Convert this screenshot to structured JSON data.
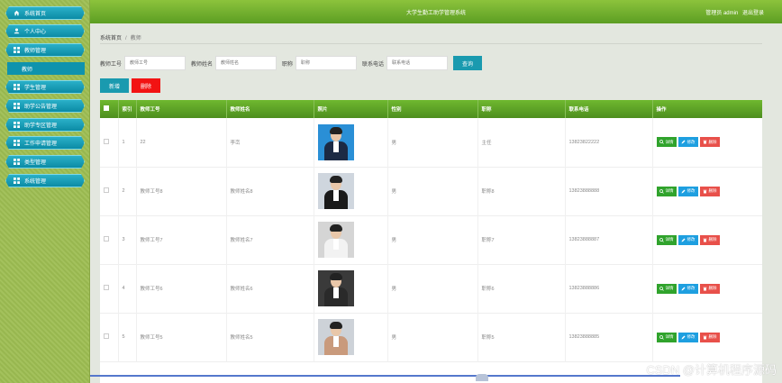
{
  "app": {
    "title": "大学生勤工助学管理系统",
    "user_label": "管理员 admin",
    "logout": "退出登录"
  },
  "sidebar": {
    "items": [
      {
        "label": "系统首页",
        "icon": "home-icon"
      },
      {
        "label": "个人中心",
        "icon": "user-icon"
      },
      {
        "label": "教师管理",
        "icon": "grid-icon"
      },
      {
        "label": "学生管理",
        "icon": "grid-icon"
      },
      {
        "label": "助学公告管理",
        "icon": "grid-icon"
      },
      {
        "label": "助学专区管理",
        "icon": "grid-icon"
      },
      {
        "label": "工作申请管理",
        "icon": "grid-icon"
      },
      {
        "label": "类型管理",
        "icon": "grid-icon"
      },
      {
        "label": "系统管理",
        "icon": "grid-icon"
      }
    ],
    "submenu": {
      "label": "教师"
    }
  },
  "breadcrumb": {
    "home": "系统首页",
    "sep": "/",
    "current": "教师"
  },
  "search": {
    "teacher_no_label": "教师工号",
    "teacher_no_placeholder": "教师工号",
    "teacher_name_label": "教师姓名",
    "teacher_name_placeholder": "教师姓名",
    "title_label": "职称",
    "title_placeholder": "职称",
    "phone_label": "联系电话",
    "phone_placeholder": "联系电话",
    "query_button": "查询"
  },
  "actions": {
    "add": "新增",
    "delete": "删除"
  },
  "table": {
    "headers": [
      "索引",
      "教师工号",
      "教师姓名",
      "照片",
      "性别",
      "职称",
      "联系电话",
      "操作"
    ],
    "rows": [
      {
        "index": "1",
        "no": "22",
        "name": "李峦",
        "gender": "男",
        "title": "主任",
        "phone": "13823822222",
        "photo_bg": "#2a8fd6",
        "suit": "#1c2a44"
      },
      {
        "index": "2",
        "no": "教师工号8",
        "name": "教师姓名8",
        "gender": "男",
        "title": "职称8",
        "phone": "13823888888",
        "photo_bg": "#cfd6de",
        "suit": "#1a1a1a"
      },
      {
        "index": "3",
        "no": "教师工号7",
        "name": "教师姓名7",
        "gender": "男",
        "title": "职称7",
        "phone": "13823888887",
        "photo_bg": "#d5d5d5",
        "suit": "#f2f2f2"
      },
      {
        "index": "4",
        "no": "教师工号6",
        "name": "教师姓名6",
        "gender": "男",
        "title": "职称6",
        "phone": "13823888886",
        "photo_bg": "#3a3a3a",
        "suit": "#2a2a2a"
      },
      {
        "index": "5",
        "no": "教师工号5",
        "name": "教师姓名5",
        "gender": "男",
        "title": "职称5",
        "phone": "13823888885",
        "photo_bg": "#cdd2d8",
        "suit": "#c99a7c"
      }
    ],
    "op_detail": "详情",
    "op_edit": "修改",
    "op_delete": "删除"
  },
  "watermark": "CSDN @计算机程序源码"
}
